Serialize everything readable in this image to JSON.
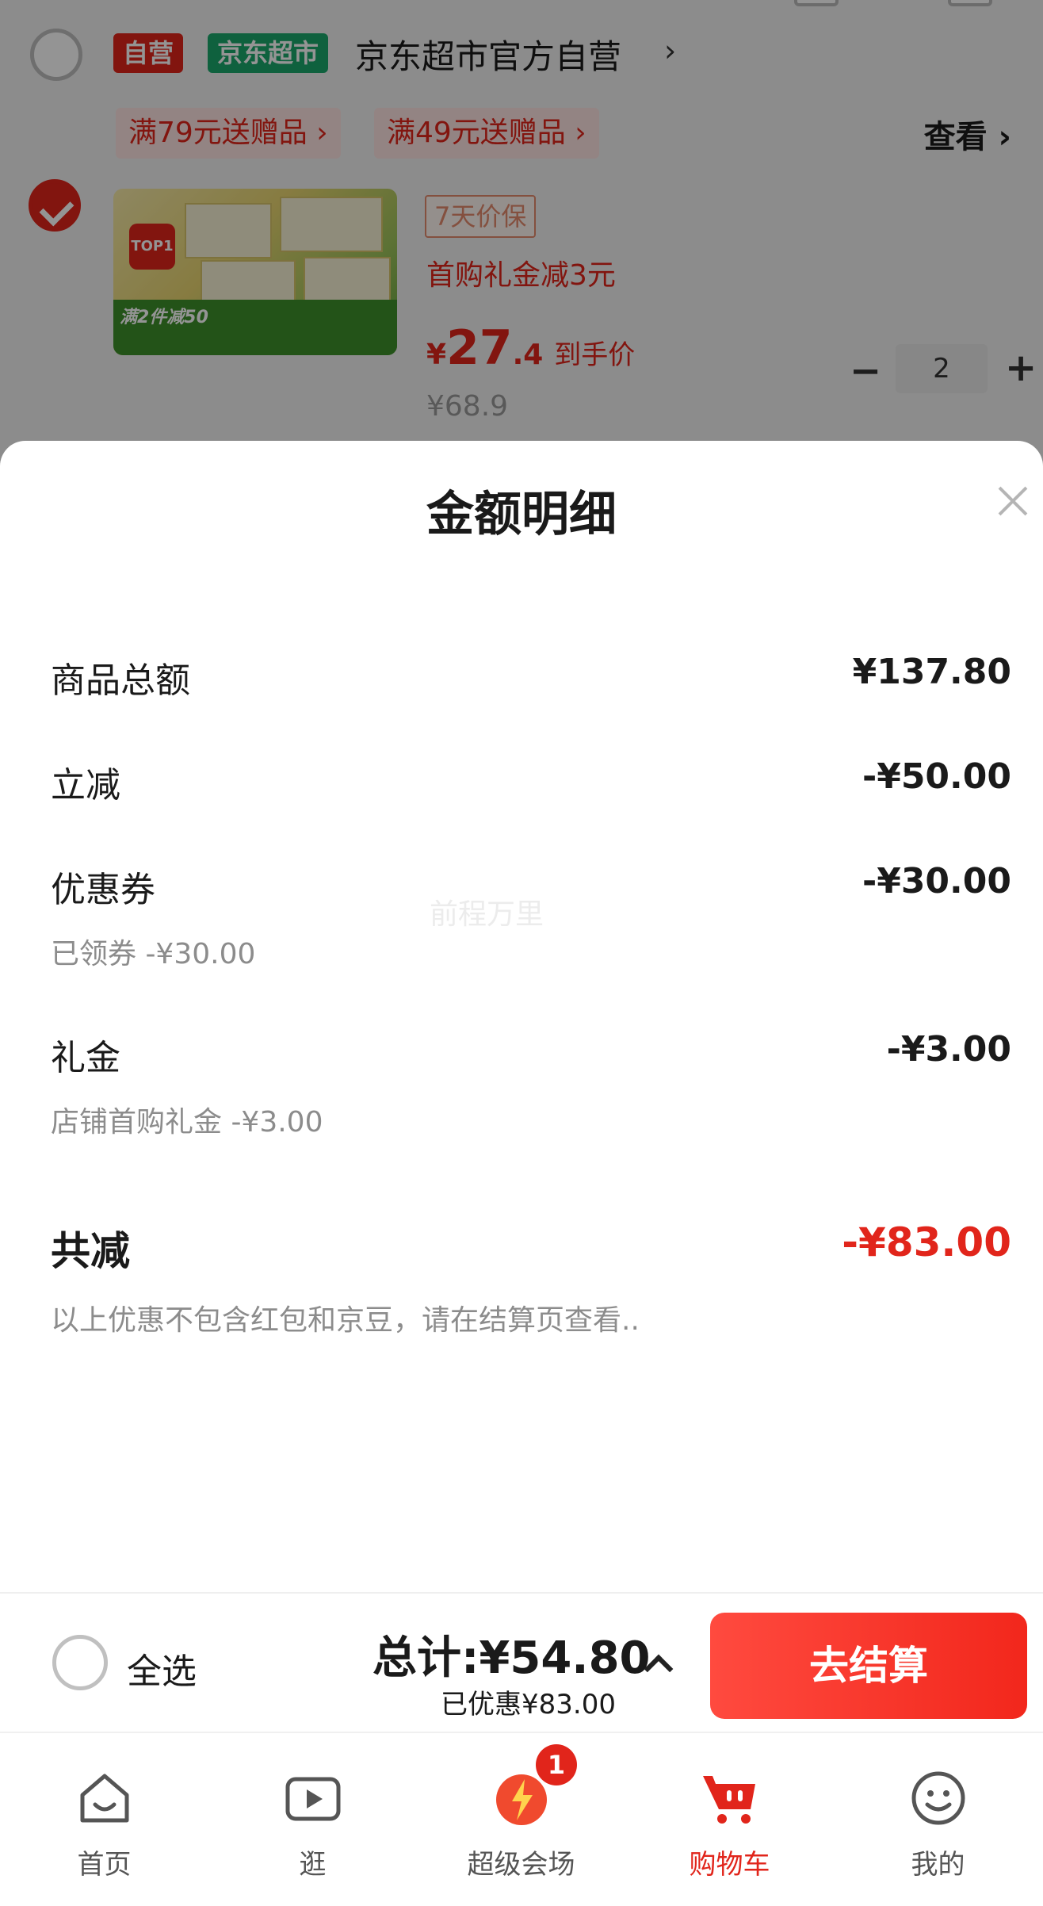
{
  "store": {
    "self_tag": "自营",
    "market_tag": "京东超市",
    "name": "京东超市官方自营",
    "arrow": "›",
    "promos": [
      "满79元送赠品 ›",
      "满49元送赠品 ›"
    ],
    "view_link": "查看 ›"
  },
  "product": {
    "image_badge": "满2件减50",
    "top_badge": "TOP1",
    "price_guard": "7天价保",
    "gift_line": "首购礼金减3元",
    "price_currency": "¥",
    "price_int": "27",
    "price_dec": ".4",
    "price_note": "到手价",
    "old_price": "¥68.9",
    "quantity": "2",
    "minus": "−",
    "plus": "+"
  },
  "sheet": {
    "title": "金额明细",
    "rows": [
      {
        "label": "商品总额",
        "value": "¥137.80"
      },
      {
        "label": "立减",
        "value": "-¥50.00"
      },
      {
        "label": "优惠券",
        "value": "-¥30.00",
        "sub": "已领券 -¥30.00"
      },
      {
        "label": "礼金",
        "value": "-¥3.00",
        "sub": "店铺首购礼金 -¥3.00"
      }
    ],
    "total_label": "共减",
    "total_value": "-¥83.00",
    "footnote": "以上优惠不包含红包和京豆，请在结算页查看..",
    "watermark": "前程万里"
  },
  "checkout": {
    "select_all": "全选",
    "total": "总计:¥54.80",
    "saved": "已优惠¥83.00",
    "button": "去结算"
  },
  "tabs": [
    {
      "label": "首页",
      "icon": "home-icon"
    },
    {
      "label": "逛",
      "icon": "video-icon"
    },
    {
      "label": "超级会场",
      "icon": "super-venue-icon",
      "badge": "1"
    },
    {
      "label": "购物车",
      "icon": "cart-icon",
      "active": true
    },
    {
      "label": "我的",
      "icon": "profile-icon"
    }
  ],
  "colors": {
    "accent": "#e1251b",
    "green_tag": "#1aa86b"
  }
}
